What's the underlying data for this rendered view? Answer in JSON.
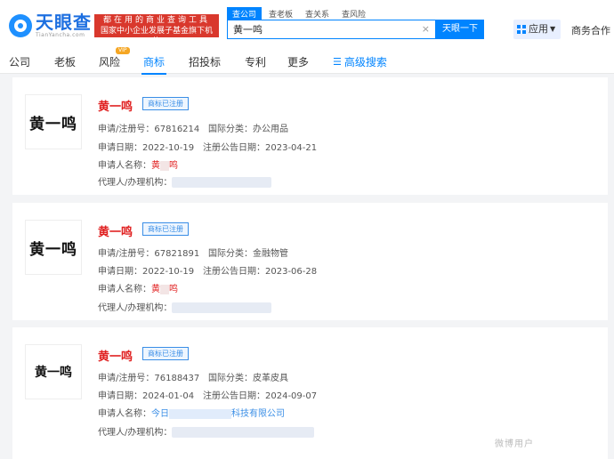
{
  "header": {
    "logo_title": "天眼查",
    "logo_sub": "TianYancha.com",
    "slogan_line1": "都在用的商业查询工具",
    "slogan_line2": "国家中小企业发展子基金旗下机构",
    "search_tabs": [
      "查公司",
      "查老板",
      "查关系",
      "查风险"
    ],
    "search_value": "黄一鸣",
    "clear_icon": "×",
    "search_button": "天眼一下",
    "app_button": "应用",
    "biz_link": "商务合作"
  },
  "nav": {
    "items": [
      "公司",
      "老板",
      "风险",
      "商标",
      "招投标",
      "专利",
      "更多"
    ],
    "active": "商标",
    "vip_badge": "VIP",
    "advanced_search": "高级搜索"
  },
  "labels": {
    "reg_no": "申请/注册号：",
    "intl_class": "国际分类：",
    "apply_date": "申请日期：",
    "publish_date": "注册公告日期：",
    "applicant": "申请人名称：",
    "agent": "代理人/办理机构："
  },
  "results": [
    {
      "image_text": "黄一鸣",
      "name": "黄一鸣",
      "status": "商标已注册",
      "reg_no": "67816214",
      "intl_class": "办公用品",
      "apply_date": "2022-10-19",
      "publish_date": "2023-04-21",
      "applicant_left": "黄",
      "applicant_right": "鸣"
    },
    {
      "image_text": "黄一鸣",
      "name": "黄一鸣",
      "status": "商标已注册",
      "reg_no": "67821891",
      "intl_class": "金融物管",
      "apply_date": "2022-10-19",
      "publish_date": "2023-06-28",
      "applicant_left": "黄",
      "applicant_right": "鸣"
    },
    {
      "image_text": "黄一鸣",
      "name": "黄一鸣",
      "status": "商标已注册",
      "reg_no": "76188437",
      "intl_class": "皮革皮具",
      "apply_date": "2024-01-04",
      "publish_date": "2024-09-07",
      "applicant_left": "今日",
      "applicant_right": "科技有限公司"
    }
  ],
  "watermark": "微博用户"
}
